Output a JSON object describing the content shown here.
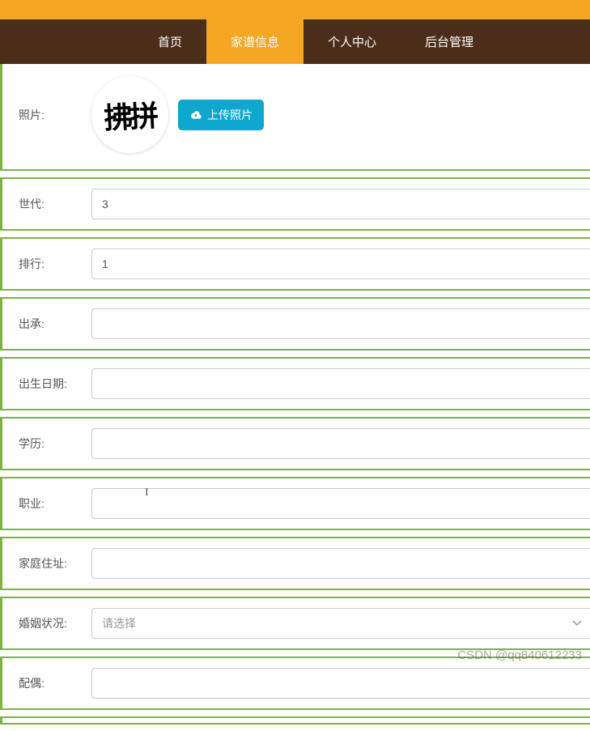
{
  "nav": {
    "items": [
      {
        "label": "首页",
        "active": false
      },
      {
        "label": "家谱信息",
        "active": true
      },
      {
        "label": "个人中心",
        "active": false
      },
      {
        "label": "后台管理",
        "active": false
      }
    ]
  },
  "form": {
    "photo": {
      "label": "照片:",
      "upload_button": "上传照片",
      "avatar_text": "拂拼"
    },
    "generation": {
      "label": "世代:",
      "value": "3"
    },
    "rank": {
      "label": "排行:",
      "value": "1"
    },
    "chucheng": {
      "label": "出承:",
      "value": ""
    },
    "birthdate": {
      "label": "出生日期:",
      "value": ""
    },
    "education": {
      "label": "学历:",
      "value": ""
    },
    "occupation": {
      "label": "职业:",
      "value": ""
    },
    "address": {
      "label": "家庭住址:",
      "value": ""
    },
    "marriage": {
      "label": "婚姻状况:",
      "placeholder": "请选择",
      "value": ""
    },
    "spouse": {
      "label": "配偶:",
      "value": ""
    }
  },
  "watermark": "CSDN @qq840612233"
}
